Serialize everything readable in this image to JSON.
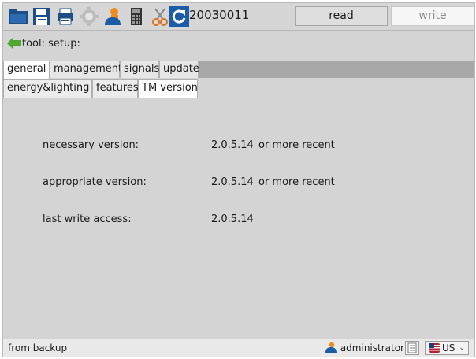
{
  "toolbar": {
    "icons": [
      "folder-icon",
      "save-icon",
      "print-icon",
      "settings-icon",
      "users-icon",
      "calculator-icon",
      "scissors-icon",
      "refresh-icon"
    ],
    "device_id": "20030011",
    "read_label": "read",
    "write_label": "write"
  },
  "path": {
    "label": "tool: setup:"
  },
  "tabs_main": [
    "general",
    "management",
    "signals",
    "update"
  ],
  "tabs_sub": [
    "energy&lighting",
    "features",
    "TM version"
  ],
  "content": {
    "rows": [
      {
        "label": "necessary version:",
        "value": "2.0.5.14",
        "note": "or more recent"
      },
      {
        "label": "appropriate version:",
        "value": "2.0.5.14",
        "note": "or more recent"
      },
      {
        "label": "last write access:",
        "value": "2.0.5.14",
        "note": ""
      }
    ]
  },
  "status": {
    "text": "from backup",
    "user": "administrator",
    "language": "US"
  },
  "colors": {
    "accent_blue": "#1a5fb4",
    "background_grey": "#d4d4d4",
    "tab_strip": "#a8a8a8"
  }
}
